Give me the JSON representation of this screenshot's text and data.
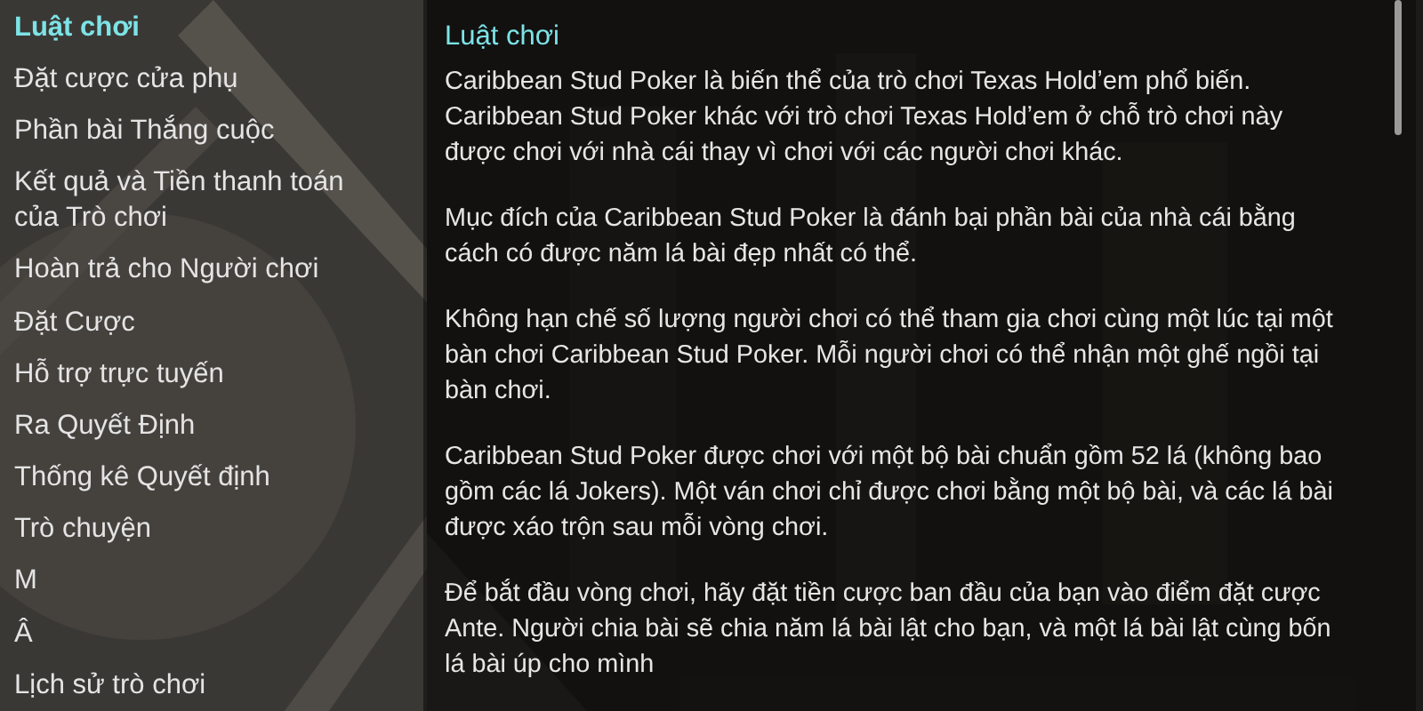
{
  "sidebar": {
    "items": [
      {
        "label": "Luật chơi",
        "selected": true
      },
      {
        "label": "Đặt cược cửa phụ",
        "selected": false
      },
      {
        "label": "Phần bài Thắng cuộc",
        "selected": false
      },
      {
        "label": "Kết quả và Tiền thanh toán của Trò chơi",
        "selected": false
      },
      {
        "label": "Hoàn trả cho Người chơi",
        "selected": false
      },
      {
        "label": "Đặt Cược",
        "selected": false
      },
      {
        "label": "Hỗ trợ trực tuyến",
        "selected": false
      },
      {
        "label": "Ra Quyết Định",
        "selected": false
      },
      {
        "label": "Thống kê Quyết định",
        "selected": false
      },
      {
        "label": "Trò chuyện",
        "selected": false
      },
      {
        "label": "M",
        "selected": false
      },
      {
        "label": "Â",
        "selected": false
      },
      {
        "label": "Lịch sử trò chơi",
        "selected": false
      }
    ]
  },
  "content": {
    "title": "Luật chơi",
    "paragraphs": [
      "Caribbean Stud Poker là biến thể của trò chơi Texas Holdʼem phổ biến. Caribbean Stud Poker khác với trò chơi Texas Holdʼem ở chỗ trò chơi này được chơi với nhà cái thay vì chơi với các người chơi khác.",
      "Mục đích của Caribbean Stud Poker là đánh bại phần bài của nhà cái bằng cách có được năm lá bài đẹp nhất có thể.",
      "Không hạn chế số lượng người chơi có thể tham gia chơi cùng một lúc tại một bàn chơi Caribbean Stud Poker. Mỗi người chơi có thể nhận một ghế ngồi tại bàn chơi.",
      "Caribbean Stud Poker được chơi với một bộ bài chuẩn gồm 52 lá (không bao gồm các lá Jokers). Một ván chơi chỉ được chơi bằng một bộ bài, và các lá bài được xáo trộn sau mỗi vòng chơi.",
      "Để bắt đầu vòng chơi, hãy đặt tiền cược ban đầu của bạn vào điểm đặt cược Ante. Người chia bài sẽ chia năm lá bài lật cho bạn, và một lá bài lật cùng bốn lá bài úp cho mình"
    ]
  }
}
